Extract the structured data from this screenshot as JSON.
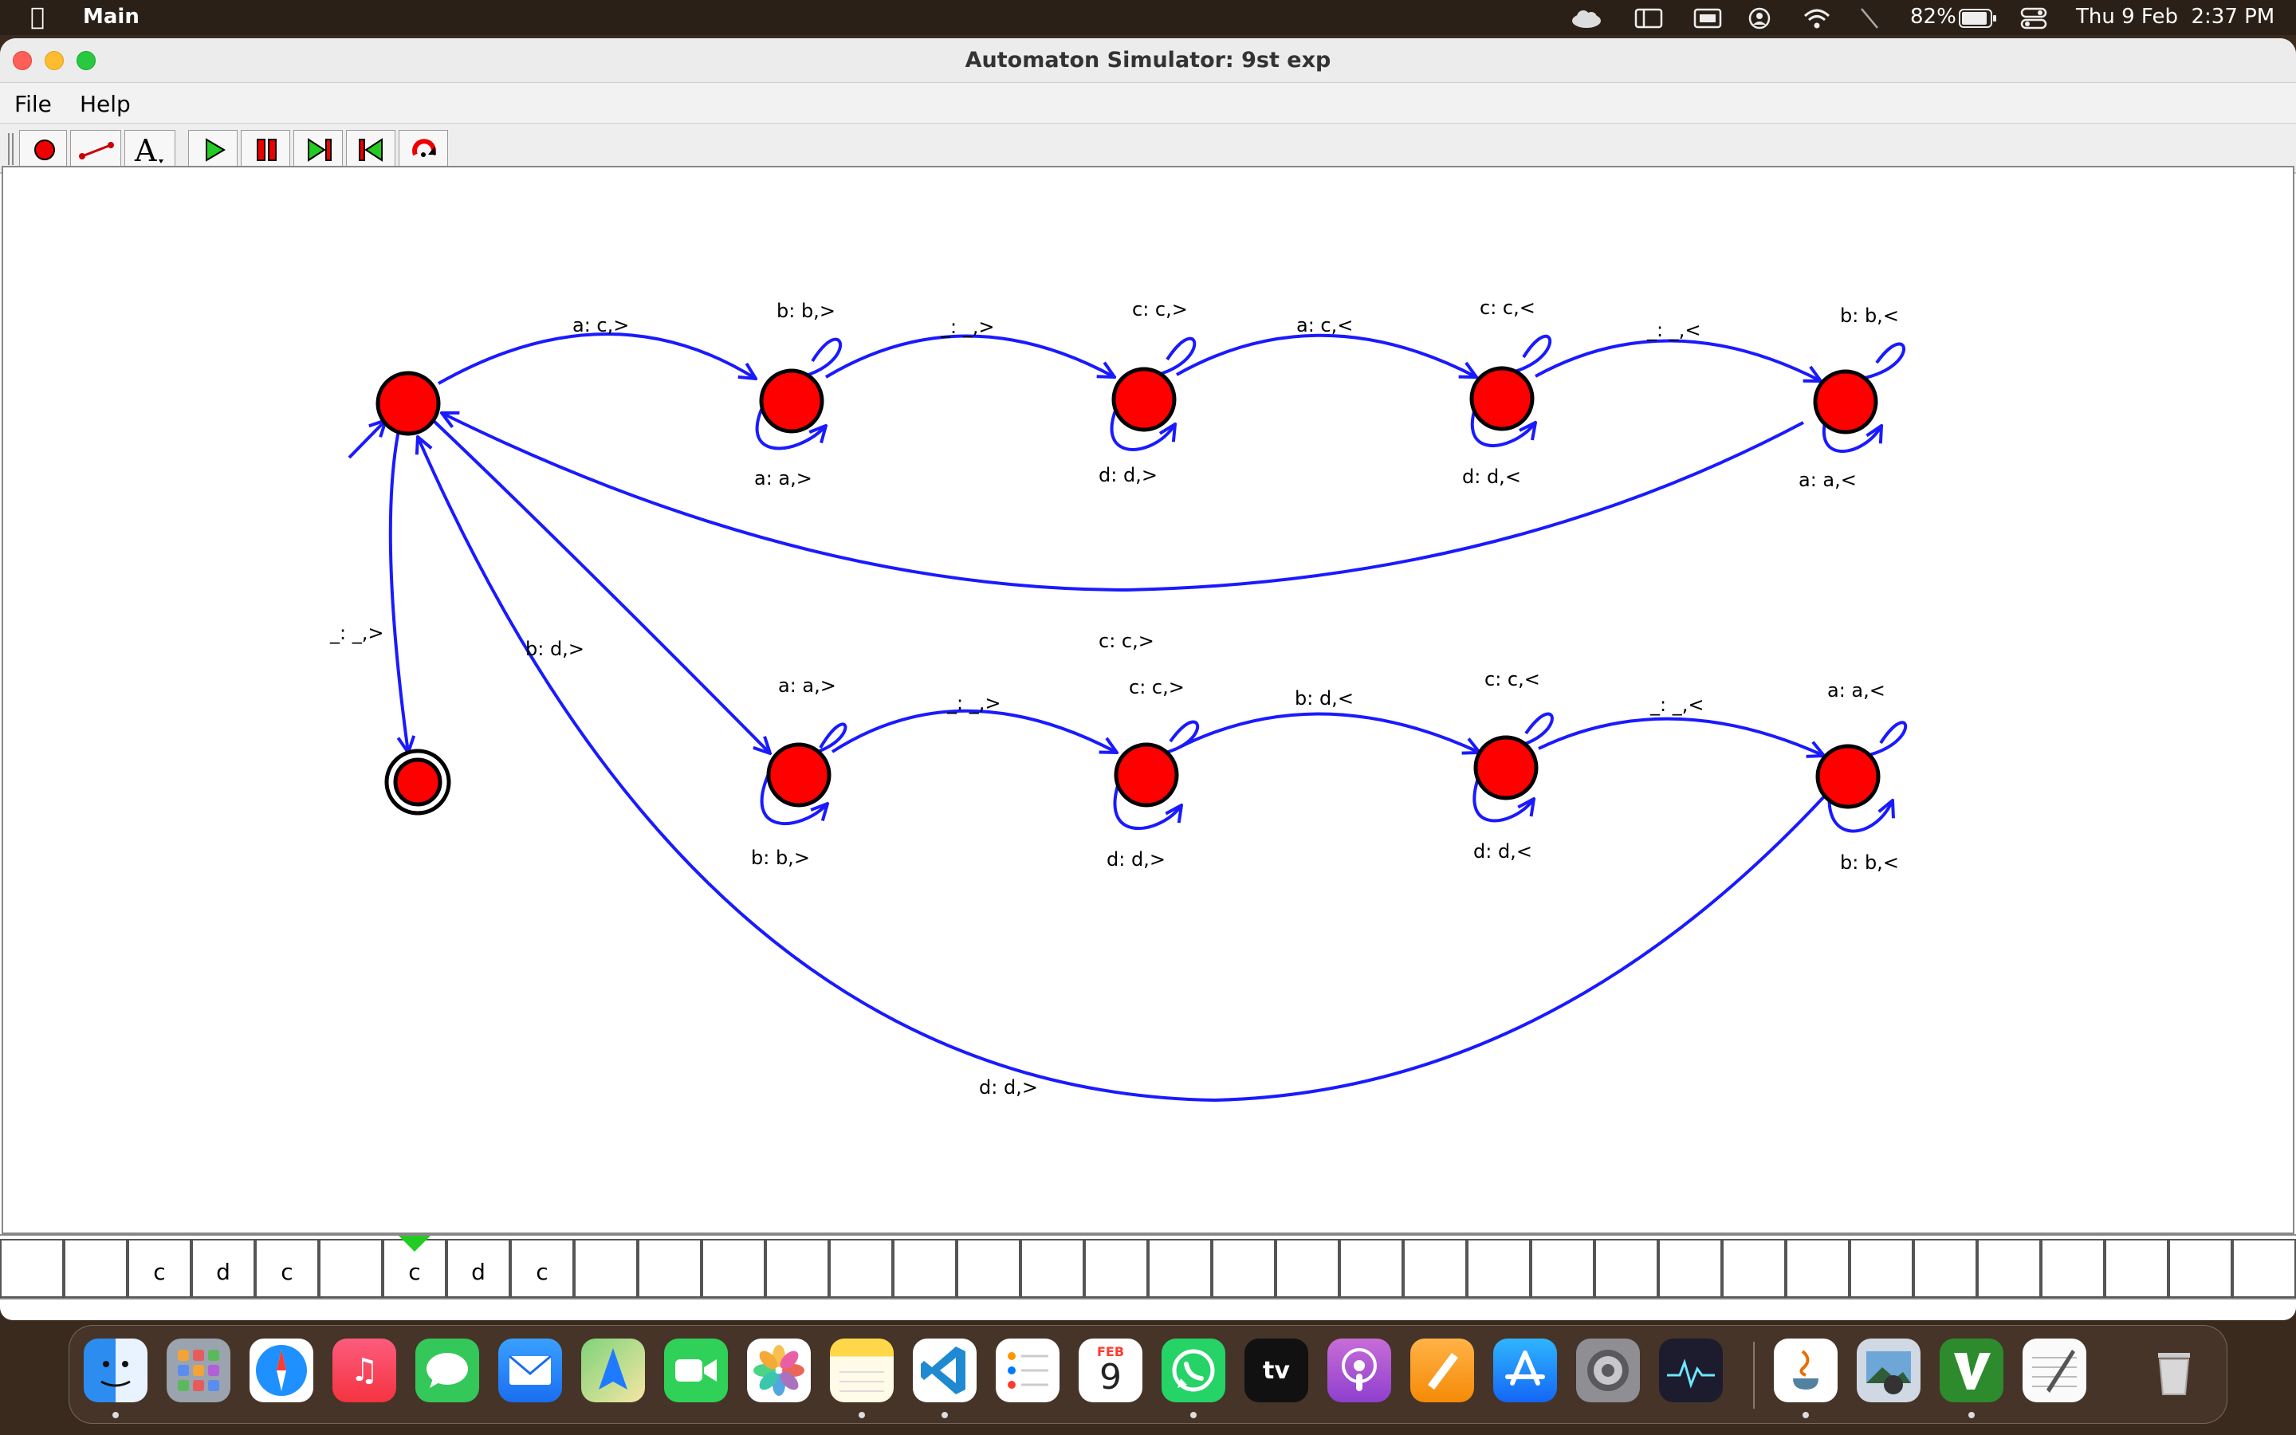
{
  "menubar": {
    "app_name": "Main",
    "battery": "82%",
    "clock": "Thu 9 Feb  2:37 PM"
  },
  "window": {
    "title": "Automaton Simulator: 9st exp",
    "menu": [
      "File",
      "Help"
    ]
  },
  "toolbar": {
    "buttons": [
      "add-state",
      "add-transition",
      "text-tool",
      "run",
      "pause",
      "step-forward",
      "rewind",
      "reset"
    ]
  },
  "automaton": {
    "edge_labels": {
      "q0_q1": "a: c,>",
      "q1_loop_top": "b: b,>",
      "q1_loop_bottom": "a: a,>",
      "q1_q2": "_: _,>",
      "q2_loop_top": "c: c,>",
      "q2_loop_bottom": "d: d,>",
      "q2_q3": "a: c,<",
      "q3_loop_top": "c: c,<",
      "q3_loop_bottom": "d: d,<",
      "q3_q4": "_: _,<",
      "q4_loop_top": "b: b,<",
      "q4_loop_bottom": "a: a,<",
      "q4_q0": "c: c,>",
      "q0_accept": "_: _,>",
      "q0_q5": "b: d,>",
      "q5_loop_top": "a: a,>",
      "q5_loop_bottom": "b: b,>",
      "q5_q6": "_: _,>",
      "q6_loop_top": "c: c,>",
      "q6_loop_bottom": "d: d,>",
      "q6_q7": "b: d,<",
      "q7_loop_top": "c: c,<",
      "q7_loop_bottom": "d: d,<",
      "q7_q8": "_: _,<",
      "q8_loop_top": "a: a,<",
      "q8_loop_bottom": "b: b,<",
      "q8_q0": "d: d,>"
    }
  },
  "tape": {
    "cells": [
      "",
      "",
      "c",
      "d",
      "c",
      "",
      "c",
      "d",
      "c",
      "",
      "",
      "",
      "",
      "",
      "",
      "",
      "",
      "",
      "",
      "",
      "",
      "",
      "",
      "",
      "",
      "",
      "",
      "",
      "",
      "",
      "",
      "",
      "",
      "",
      "",
      ""
    ],
    "head_index": 6
  },
  "dock": {
    "apps": [
      "finder",
      "launchpad",
      "safari",
      "music",
      "messages",
      "mail",
      "maps",
      "facetime",
      "photos",
      "notes",
      "vscode",
      "reminders",
      "calendar",
      "whatsapp",
      "apple-tv",
      "podcasts",
      "pages",
      "app-store",
      "system-settings",
      "activity-monitor",
      "java",
      "preview",
      "vim",
      "textedit",
      "trash"
    ],
    "calendar_month": "FEB",
    "calendar_day": "9",
    "tv_label": "tv"
  }
}
